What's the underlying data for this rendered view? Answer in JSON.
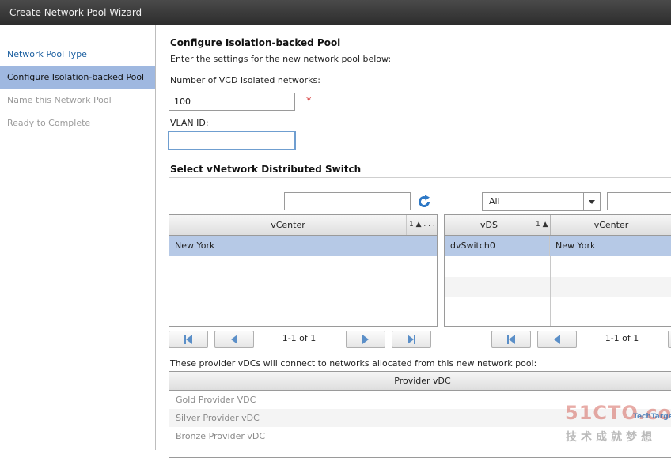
{
  "window": {
    "title": "Create Network Pool Wizard"
  },
  "sidebar": {
    "items": [
      {
        "label": "Network Pool Type",
        "state": "link"
      },
      {
        "label": "Configure Isolation-backed Pool",
        "state": "active"
      },
      {
        "label": "Name this Network Pool",
        "state": "disabled"
      },
      {
        "label": "Ready to Complete",
        "state": "disabled"
      }
    ]
  },
  "main": {
    "heading": "Configure Isolation-backed Pool",
    "subheading": "Enter the settings for the new network pool below:",
    "isolated_label": "Number of VCD isolated networks:",
    "isolated_value": "100",
    "required_marker": "*",
    "vlan_label": "VLAN ID:",
    "vlan_value": "",
    "switch_heading": "Select vNetwork Distributed Switch"
  },
  "left_grid": {
    "search_value": "",
    "header": "vCenter",
    "sort_label": "1 ▲ . . .",
    "rows": [
      {
        "vcenter": "New York"
      }
    ],
    "pager_text": "1-1 of 1"
  },
  "right_grid": {
    "filter_value": "All",
    "search_value": "",
    "header_vds": "vDS",
    "sort_label": "1 ▲",
    "header_vcenter": "vCenter",
    "rows": [
      {
        "vds": "dvSwitch0",
        "vcenter": "New York"
      }
    ],
    "pager_text": "1-1 of 1"
  },
  "vdc_section": {
    "description": "These provider vDCs will connect to networks allocated from this new network pool:",
    "header": "Provider vDC",
    "rows": [
      "Gold Provider VDC",
      "Silver Provider vDC",
      "Bronze Provider vDC"
    ]
  },
  "watermark": {
    "site": "51CTO.com",
    "tagline": "技术成就梦想",
    "brand": "TechTarget"
  },
  "colors": {
    "selected_row": "#b6c9e6",
    "active_nav": "#9fb8e0",
    "link": "#1b5fa0",
    "required": "#d02020"
  }
}
